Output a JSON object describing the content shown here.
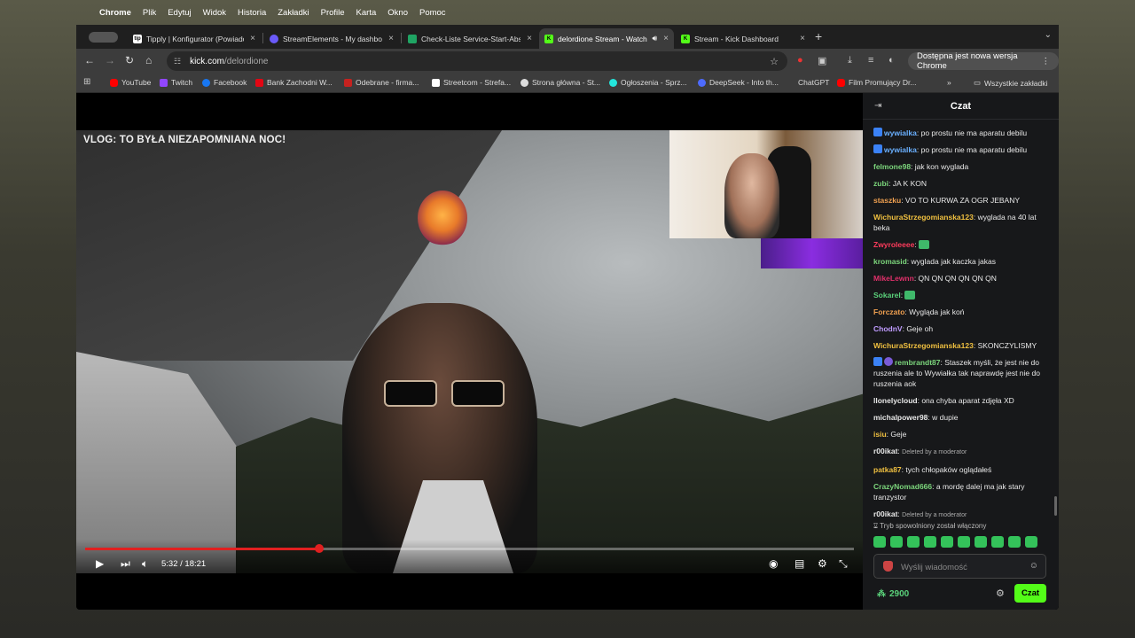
{
  "menubar": {
    "app": "Chrome",
    "items": [
      "Plik",
      "Edytuj",
      "Widok",
      "Historia",
      "Zakładki",
      "Profile",
      "Karta",
      "Okno",
      "Pomoc"
    ]
  },
  "tabs": [
    {
      "label": "Tipply | Konfigurator (Powiadomienia)",
      "fav_color": "#ffffff",
      "fav_text": "tip"
    },
    {
      "label": "StreamElements - My dashboard",
      "fav_color": "#6a5af9",
      "fav_text": ""
    },
    {
      "label": "Check-Liste Service-Start-Abschluss",
      "fav_color": "#1fa463",
      "fav_text": ""
    },
    {
      "label": "delordione Stream - Watch Live",
      "fav_color": "#53fc18",
      "fav_text": "K"
    },
    {
      "label": "Stream - Kick Dashboard",
      "fav_color": "#53fc18",
      "fav_text": "K"
    }
  ],
  "address": {
    "host": "kick.com",
    "path": "/delordione"
  },
  "update_label": "Dostępna jest nowa wersja Chrome",
  "bookmarks": [
    {
      "label": "YouTube",
      "color": "#ff0000"
    },
    {
      "label": "Twitch",
      "color": "#9146ff"
    },
    {
      "label": "Facebook",
      "color": "#1877f2"
    },
    {
      "label": "Bank Zachodni W...",
      "color": "#e30613"
    },
    {
      "label": "Odebrane - firma...",
      "color": "#c5221f"
    },
    {
      "label": "Streetcom - Strefa...",
      "color": "#ffffff"
    },
    {
      "label": "Strona główna - St...",
      "color": "#dddddd"
    },
    {
      "label": "Ogłoszenia - Sprz...",
      "color": "#23e5db"
    },
    {
      "label": "DeepSeek - Into th...",
      "color": "#4d6bfe"
    },
    {
      "label": "ChatGPT",
      "color": "#3c3c3c"
    },
    {
      "label": "Film Promujący Dr...",
      "color": "#ff0000"
    }
  ],
  "all_bookmarks": "Wszystkie zakładki",
  "video": {
    "title": "VLOG: TO BYŁA NIEZAPOMNIANA NOC!",
    "time": "5:32 / 18:21",
    "progress": 0.305
  },
  "chat": {
    "title": "Czat",
    "messages": [
      {
        "badges": [
          "b"
        ],
        "user": "wywialka",
        "color": "#6ab0ff",
        "text": "po prostu nie ma aparatu debilu"
      },
      {
        "badges": [
          "b"
        ],
        "user": "wywialka",
        "color": "#6ab0ff",
        "text": "po prostu nie ma aparatu debilu"
      },
      {
        "badges": [],
        "user": "felmone98",
        "color": "#7cd67c",
        "text": "jak kon wyglada"
      },
      {
        "badges": [],
        "user": "zubi",
        "color": "#7cd67c",
        "text": "JA K KON"
      },
      {
        "badges": [],
        "user": "staszku",
        "color": "#f0a050",
        "text": "VO TO KURWA ZA OGR JEBANY"
      },
      {
        "badges": [],
        "user": "WichuraStrzegomianska123",
        "color": "#f0c040",
        "text": "wyglada na 40 lat beka"
      },
      {
        "badges": [],
        "user": "Zwyroleeee",
        "color": "#ff3b5c",
        "text": "",
        "emote": true
      },
      {
        "badges": [],
        "user": "kromasid",
        "color": "#7cd67c",
        "text": "wyglada jak kaczka jakas"
      },
      {
        "badges": [],
        "user": "MikeLewnn",
        "color": "#e0306a",
        "text": "QN QN QN QN QN QN"
      },
      {
        "badges": [],
        "user": "Sokarel",
        "color": "#5ad17a",
        "text": "",
        "emote": true
      },
      {
        "badges": [],
        "user": "Forczato",
        "color": "#f0a050",
        "text": "Wygląda jak koń"
      },
      {
        "badges": [],
        "user": "ChodnV",
        "color": "#c09cff",
        "text": "Geje oh"
      },
      {
        "badges": [],
        "user": "WichuraStrzegomianska123",
        "color": "#f0c040",
        "text": "SKONCZYLISMY"
      },
      {
        "badges": [
          "b",
          "s"
        ],
        "user": "rembrandt87",
        "color": "#7cd67c",
        "text": "Staszek myśli, że jest nie do ruszenia ale to Wywiałka tak naprawdę jest nie do ruszenia aok"
      },
      {
        "badges": [],
        "user": "llonelycloud",
        "color": "#e8e8e8",
        "text": "ona chyba aparat zdjęła XD"
      },
      {
        "badges": [],
        "user": "michalpower98",
        "color": "#e8e8e8",
        "text": "w dupie"
      },
      {
        "badges": [],
        "user": "isiu",
        "color": "#f0c040",
        "text": "Geje"
      },
      {
        "badges": [],
        "user": "r00ikat",
        "color": "#e8e8e8",
        "text": "",
        "deleted": "Deleted by a moderator"
      },
      {
        "badges": [],
        "user": "patka87",
        "color": "#f0c040",
        "text": "tych chłopaków oglądałeś"
      },
      {
        "badges": [],
        "user": "CrazyNomad666",
        "color": "#7cd67c",
        "text": "a mordę dalej ma jak stary tranzystor"
      },
      {
        "badges": [],
        "user": "r00ikat",
        "color": "#e8e8e8",
        "text": "",
        "deleted": "Deleted by a moderator"
      }
    ],
    "slow_mode": "Tryb spowolniony został włączony",
    "input_placeholder": "Wyślij wiadomość",
    "points": "2900",
    "send_label": "Czat"
  },
  "colors": {
    "kick_green": "#53fc18",
    "progress_red": "#e02020"
  }
}
